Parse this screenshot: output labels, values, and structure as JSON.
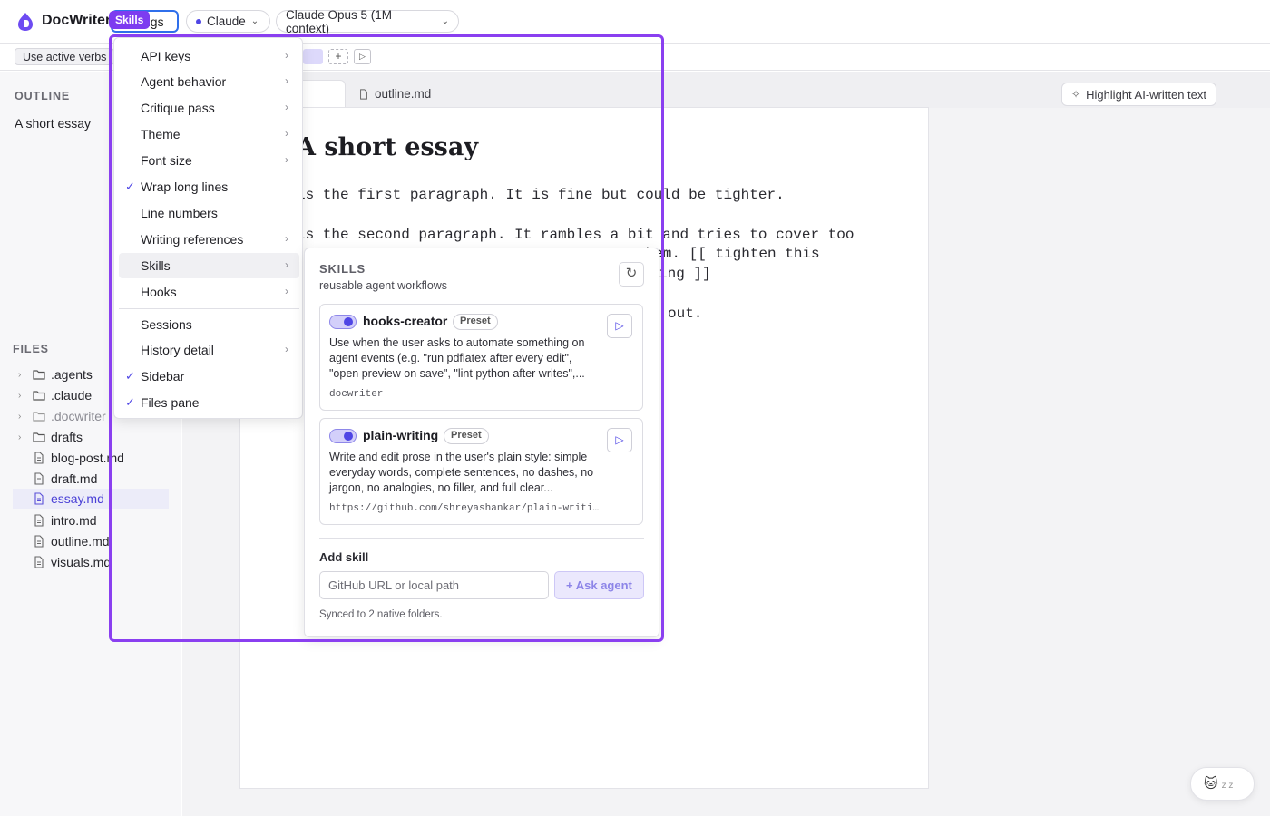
{
  "app": {
    "name": "DocWriter"
  },
  "topbar": {
    "settings_label": "Settings",
    "settings_visible": "ngs",
    "tooltip": "Skills",
    "provider": "Claude",
    "model": "Claude Opus 5 (1M context)"
  },
  "promptbar": {
    "chip": "Use active verbs"
  },
  "sidebar": {
    "outline_title": "OUTLINE",
    "outline_items": [
      "A short essay"
    ],
    "files_title": "FILES",
    "tree": [
      {
        "name": ".agents",
        "type": "folder"
      },
      {
        "name": ".claude",
        "type": "folder"
      },
      {
        "name": ".docwriter",
        "type": "folder"
      },
      {
        "name": "drafts",
        "type": "folder"
      },
      {
        "name": "blog-post.md",
        "type": "file"
      },
      {
        "name": "draft.md",
        "type": "file"
      },
      {
        "name": "essay.md",
        "type": "file",
        "active": true
      },
      {
        "name": "intro.md",
        "type": "file"
      },
      {
        "name": "outline.md",
        "type": "file"
      },
      {
        "name": "visuals.md",
        "type": "file"
      }
    ]
  },
  "editor": {
    "tabs": [
      {
        "label": "nd",
        "active": true
      },
      {
        "label": "outline.md",
        "active": false
      }
    ],
    "highlight_button": "Highlight AI-written text",
    "doc_title": "A short essay",
    "lines": [
      "is the first paragraph. It is fine but could be tighter.",
      "is the second paragraph. It rambles a bit and tries to cover too",
      "them. [[ tighten this",
      "ing ]]",
      "out."
    ]
  },
  "settings_menu": {
    "items": [
      {
        "label": "API keys",
        "submenu": true
      },
      {
        "label": "Agent behavior",
        "submenu": true
      },
      {
        "label": "Critique pass",
        "submenu": true
      },
      {
        "label": "Theme",
        "submenu": true
      },
      {
        "label": "Font size",
        "submenu": true
      },
      {
        "label": "Wrap long lines",
        "checked": true
      },
      {
        "label": "Line numbers"
      },
      {
        "label": "Writing references",
        "submenu": true
      },
      {
        "label": "Skills",
        "submenu": true,
        "highlighted": true
      },
      {
        "label": "Hooks",
        "submenu": true
      },
      {
        "label": "Sessions"
      },
      {
        "label": "History detail",
        "submenu": true
      },
      {
        "label": "Sidebar",
        "checked": true
      },
      {
        "label": "Files pane",
        "checked": true
      }
    ]
  },
  "skills_panel": {
    "title": "SKILLS",
    "subtitle": "reusable agent workflows",
    "skills": [
      {
        "name": "hooks-creator",
        "badge": "Preset",
        "enabled": true,
        "description": "Use when the user asks to automate something on agent events (e.g. \"run pdflatex after every edit\", \"open preview on save\", \"lint python after writes\",...",
        "source": "docwriter"
      },
      {
        "name": "plain-writing",
        "badge": "Preset",
        "enabled": true,
        "description": "Write and edit prose in the user's plain style: simple everyday words, complete sentences, no dashes, no jargon, no analogies, no filler, and full clear...",
        "source": "https://github.com/shreyashankar/plain-writing..."
      }
    ],
    "add_label": "Add skill",
    "input_placeholder": "GitHub URL or local path",
    "ask_agent": "Ask agent",
    "sync_note": "Synced to 2 native folders."
  },
  "colors": {
    "accent": "#4f46e5",
    "highlight_frame": "#8a3ff0",
    "focus": "#2f6feb"
  },
  "mascot": {
    "icon": "cat-icon",
    "status": "z z"
  }
}
